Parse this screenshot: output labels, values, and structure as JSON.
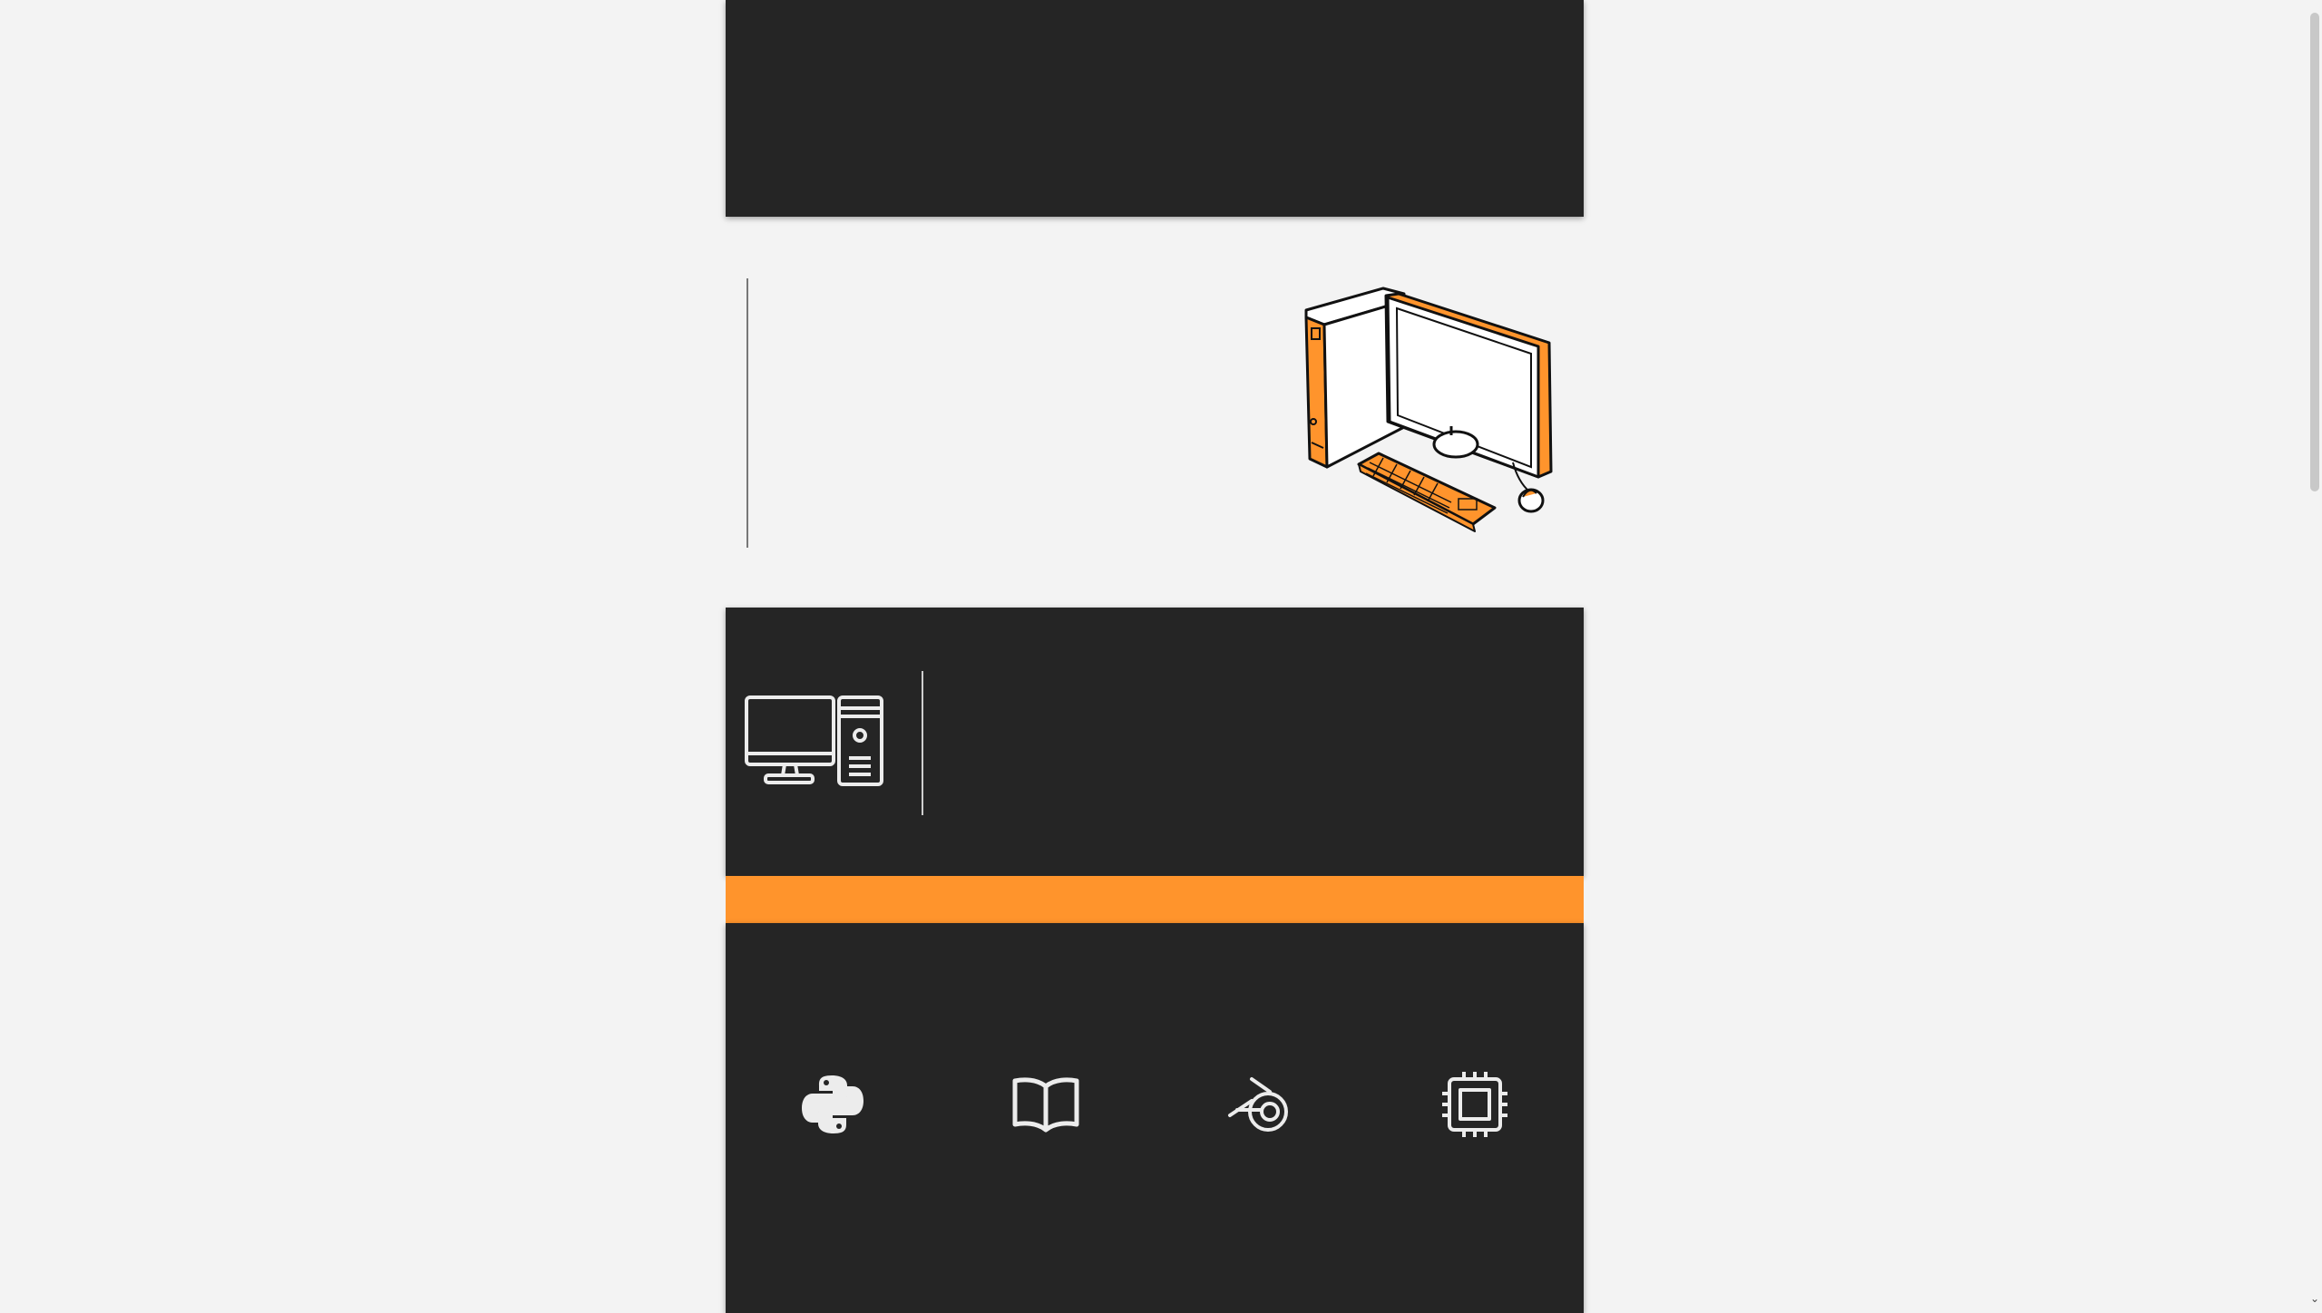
{
  "page": {
    "background": "#f3f3f3",
    "panel_color": "#252525",
    "accent_color": "#ff942c"
  },
  "hero": {
    "illustration": "desktop-computer-illustration"
  },
  "info_card": {
    "icon": "desktop-computer-icon"
  },
  "skills": {
    "items": [
      {
        "icon": "python-icon"
      },
      {
        "icon": "open-book-icon"
      },
      {
        "icon": "blender-icon"
      },
      {
        "icon": "cpu-chip-icon"
      }
    ]
  },
  "scrollbar": {
    "arrow_glyph": "⌄"
  }
}
